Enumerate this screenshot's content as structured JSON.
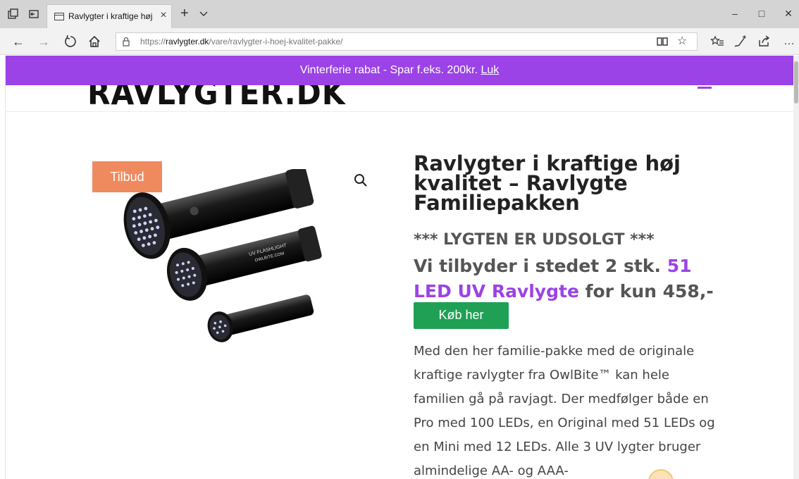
{
  "browser": {
    "tab": {
      "title": "Ravlygter i kraftige høj l",
      "close_icon": "close-icon"
    },
    "window_controls": {
      "minimize": "–",
      "maximize": "□",
      "close": "✕"
    },
    "address": {
      "url_prefix": "https://",
      "url_domain": "ravlygter.dk",
      "url_path": "/vare/ravlygter-i-hoej-kvalitet-pakke/"
    },
    "toolbar_icons": [
      "reading-view-icon",
      "favorite-star-icon",
      "favorites-list-icon",
      "pen-icon",
      "share-icon",
      "more-icon"
    ]
  },
  "promo": {
    "text": "Vinterferie rabat - Spar f.eks. 200kr.",
    "link": "Luk",
    "background": "#9b43e6"
  },
  "header": {
    "logo_text": "RAVLYGTER.DK"
  },
  "product": {
    "badge": "Tilbud",
    "title": "Ravlygter i kraftige høj kvalitet – Ravlygte Familiepakken",
    "soldout": "*** LYGTEN ER UDSOLGT ***",
    "offer_prefix": "Vi tilbyder i stedet 2 stk.",
    "offer_link": "51 LED UV Ravlygte",
    "offer_suffix": "for kun 458,-",
    "buy_button": "Køb her",
    "description": "Med den her familie-pakke med de originale kraftige ravlygter fra OwlBite™ kan hele familien gå på ravjagt. Der medfølger både en Pro med 100 LEDs, en Original med 51 LEDs og en Mini med 12 LEDs. Alle 3 UV lygter bruger almindelige AA- og AAA-",
    "image_label_1": "UV FLASHLIGHT",
    "image_label_2": "OWLBITE.COM"
  },
  "colors": {
    "accent": "#9b43e6",
    "badge": "#ef8a5e",
    "button": "#1fa055"
  }
}
